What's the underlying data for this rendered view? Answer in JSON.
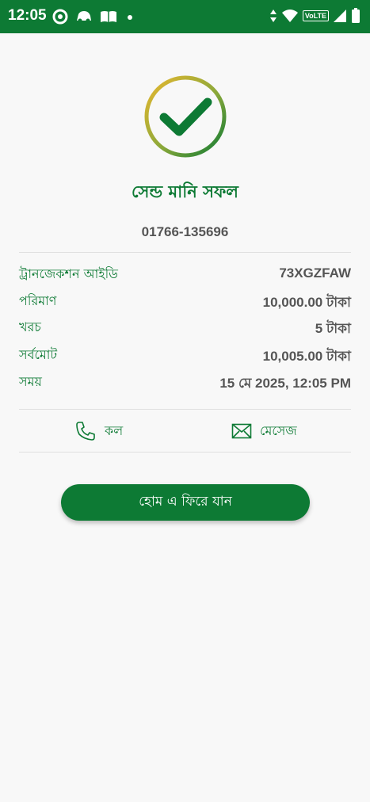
{
  "status_bar": {
    "time": "12:05",
    "notification_icons": [
      "tracker-icon",
      "car-icon",
      "book-icon",
      "dot-icon"
    ],
    "network_label": "VoLTE",
    "system_icons": [
      "data-arrows-icon",
      "wifi-icon",
      "signal-icon",
      "battery-icon"
    ]
  },
  "result": {
    "title": "সেন্ড মানি সফল",
    "phone": "01766-135696"
  },
  "details": [
    {
      "label": "ট্রানজেকশন আইডি",
      "value": "73XGZFAW"
    },
    {
      "label": "পরিমাণ",
      "value": "10,000.00 টাকা"
    },
    {
      "label": "খরচ",
      "value": "5 টাকা"
    },
    {
      "label": "সর্বমোট",
      "value": "10,005.00 টাকা"
    },
    {
      "label": "সময়",
      "value": "15 মে 2025, 12:05 PM"
    }
  ],
  "actions": {
    "call_label": "কল",
    "message_label": "মেসেজ"
  },
  "home_button": "হোম এ ফিরে যান",
  "colors": {
    "brand_green": "#0d7a34",
    "check_ring_gold": "#e0b030",
    "value_gray": "#555555"
  }
}
